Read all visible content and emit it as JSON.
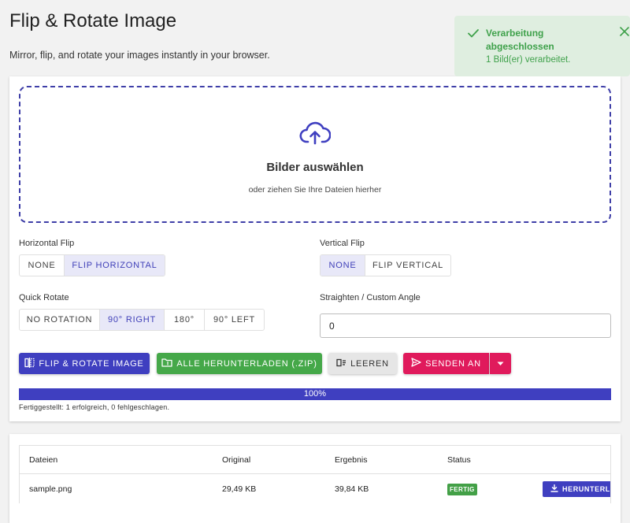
{
  "header": {
    "title": "Flip & Rotate Image",
    "subtitle": "Mirror, flip, and rotate your images instantly in your browser."
  },
  "toast": {
    "title": "Verarbeitung abgeschlossen",
    "message": "1 Bild(er) verarbeitet.",
    "icon": "check-icon",
    "close_icon": "close-icon"
  },
  "dropzone": {
    "title": "Bilder auswählen",
    "subtitle": "oder ziehen Sie Ihre Dateien hierher",
    "icon": "cloud-upload-icon"
  },
  "horizontal_flip": {
    "label": "Horizontal Flip",
    "options": [
      "NONE",
      "FLIP HORIZONTAL"
    ],
    "selected": "FLIP HORIZONTAL"
  },
  "vertical_flip": {
    "label": "Vertical Flip",
    "options": [
      "NONE",
      "FLIP VERTICAL"
    ],
    "selected": "NONE"
  },
  "quick_rotate": {
    "label": "Quick Rotate",
    "options": [
      "NO ROTATION",
      "90° RIGHT",
      "180°",
      "90° LEFT"
    ],
    "selected": "90° RIGHT"
  },
  "custom_angle": {
    "label": "Straighten / Custom Angle",
    "value": "0"
  },
  "actions": {
    "flip_label": "FLIP & ROTATE IMAGE",
    "zip_label": "ALLE HERUNTERLADEN (.ZIP)",
    "clear_label": "LEEREN",
    "send_label": "SENDEN AN"
  },
  "progress": {
    "value": 100,
    "label": "100%",
    "status": "Fertiggestellt: 1 erfolgreich, 0 fehlgeschlagen."
  },
  "table": {
    "columns": [
      "Dateien",
      "Original",
      "Ergebnis",
      "Status"
    ],
    "rows": [
      {
        "file": "sample.png",
        "original": "29,49 KB",
        "result": "39,84 KB",
        "status": "FERTIG",
        "action": "HERUNTERLADEN"
      }
    ]
  },
  "colors": {
    "primary": "#3f3fc0",
    "success": "#45a849",
    "danger": "#e01a5c",
    "toast_bg": "#dfeee0"
  }
}
